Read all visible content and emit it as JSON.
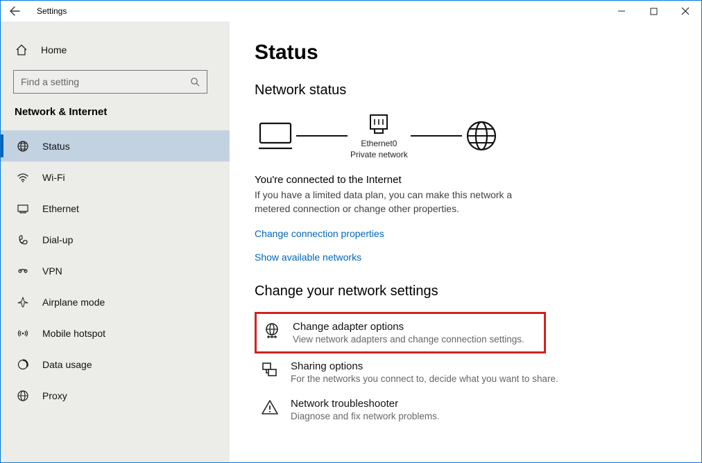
{
  "window": {
    "title": "Settings"
  },
  "sidebar": {
    "home": "Home",
    "search_placeholder": "Find a setting",
    "section": "Network & Internet",
    "items": [
      {
        "label": "Status"
      },
      {
        "label": "Wi-Fi"
      },
      {
        "label": "Ethernet"
      },
      {
        "label": "Dial-up"
      },
      {
        "label": "VPN"
      },
      {
        "label": "Airplane mode"
      },
      {
        "label": "Mobile hotspot"
      },
      {
        "label": "Data usage"
      },
      {
        "label": "Proxy"
      }
    ]
  },
  "main": {
    "page_title": "Status",
    "section1": "Network status",
    "diagram": {
      "adapter_name": "Ethernet0",
      "adapter_type": "Private network"
    },
    "connected_title": "You're connected to the Internet",
    "connected_sub": "If you have a limited data plan, you can make this network a metered connection or change other properties.",
    "link_change_props": "Change connection properties",
    "link_show_networks": "Show available networks",
    "section2": "Change your network settings",
    "cards": [
      {
        "title": "Change adapter options",
        "sub": "View network adapters and change connection settings."
      },
      {
        "title": "Sharing options",
        "sub": "For the networks you connect to, decide what you want to share."
      },
      {
        "title": "Network troubleshooter",
        "sub": "Diagnose and fix network problems."
      }
    ]
  }
}
